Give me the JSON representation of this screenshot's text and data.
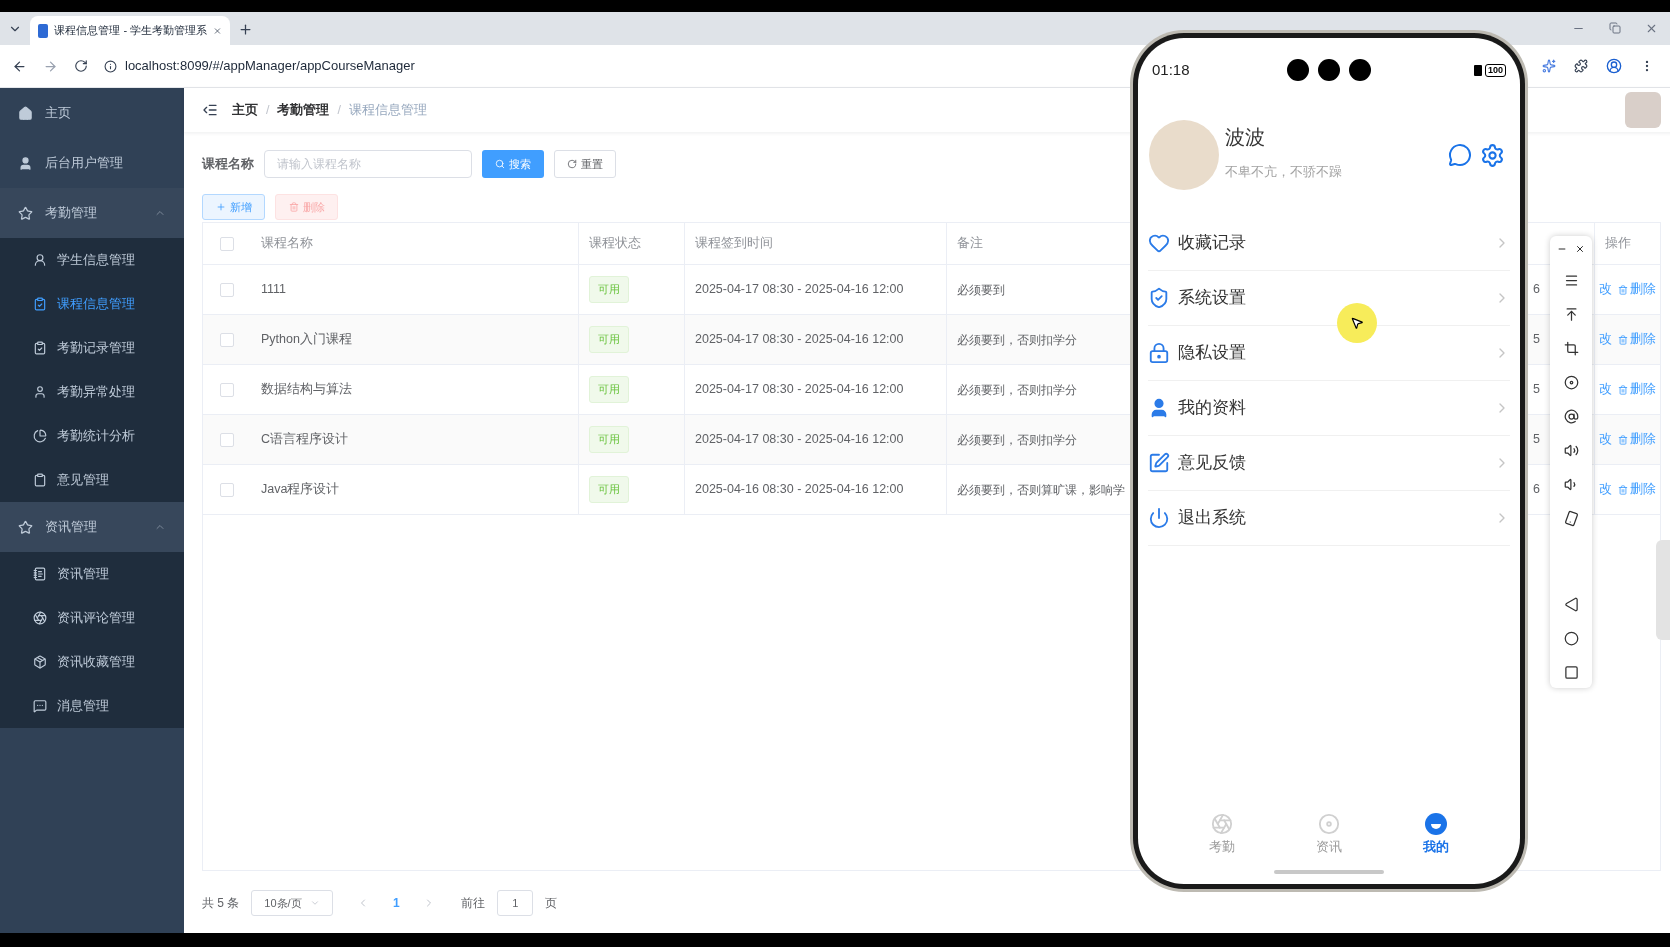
{
  "browser": {
    "tab_title": "课程信息管理 - 学生考勤管理系",
    "url": "localhost:8099/#/appManager/appCourseManager"
  },
  "sidebar": {
    "items": [
      {
        "label": "主页",
        "selected": false
      },
      {
        "label": "后台用户管理",
        "selected": false
      },
      {
        "label": "考勤管理",
        "selected": false,
        "expanded": true,
        "children": [
          {
            "label": "学生信息管理",
            "selected": false
          },
          {
            "label": "课程信息管理",
            "selected": true
          },
          {
            "label": "考勤记录管理",
            "selected": false
          },
          {
            "label": "考勤异常处理",
            "selected": false
          },
          {
            "label": "考勤统计分析",
            "selected": false
          },
          {
            "label": "意见管理",
            "selected": false
          }
        ]
      },
      {
        "label": "资讯管理",
        "selected": false,
        "expanded": true,
        "children": [
          {
            "label": "资讯管理",
            "selected": false
          },
          {
            "label": "资讯评论管理",
            "selected": false
          },
          {
            "label": "资讯收藏管理",
            "selected": false
          },
          {
            "label": "消息管理",
            "selected": false
          }
        ]
      }
    ]
  },
  "breadcrumb": {
    "separator": "/",
    "items": [
      "主页",
      "考勤管理",
      "课程信息管理"
    ]
  },
  "search": {
    "label": "课程名称",
    "placeholder": "请输入课程名称",
    "search_button": "搜索",
    "reset_button": "重置"
  },
  "actions": [
    {
      "label": "新增",
      "disabled": false
    },
    {
      "label": "删除",
      "disabled": true
    }
  ],
  "table": {
    "header_checked": false,
    "columns": [
      "课程名称",
      "课程状态",
      "课程签到时间",
      "备注",
      "操作"
    ],
    "rows": [
      {
        "checked": false,
        "name": "1111",
        "status": "可用",
        "time": "2025-04-17 08:30 - 2025-04-16 12:00",
        "remark": "必须要到",
        "column_5": "6",
        "actions": [
          "改",
          "删除"
        ]
      },
      {
        "checked": false,
        "name": "Python入门课程",
        "status": "可用",
        "time": "2025-04-17 08:30 - 2025-04-16 12:00",
        "remark": "必须要到，否则扣学分",
        "column_5": "5",
        "actions": [
          "改",
          "删除"
        ]
      },
      {
        "checked": false,
        "name": "数据结构与算法",
        "status": "可用",
        "time": "2025-04-17 08:30 - 2025-04-16 12:00",
        "remark": "必须要到，否则扣学分",
        "column_5": "5",
        "actions": [
          "改",
          "删除"
        ]
      },
      {
        "checked": false,
        "name": "C语言程序设计",
        "status": "可用",
        "time": "2025-04-17 08:30 - 2025-04-16 12:00",
        "remark": "必须要到，否则扣学分",
        "column_5": "5",
        "actions": [
          "改",
          "删除"
        ]
      },
      {
        "checked": false,
        "name": "Java程序设计",
        "status": "可用",
        "time": "2025-04-16 08:30 - 2025-04-16 12:00",
        "remark": "必须要到，否则算旷课，影响学",
        "column_5": "6",
        "actions": [
          "改",
          "删除"
        ]
      }
    ]
  },
  "pagination": {
    "total": "共 5 条",
    "page_size": "10条/页",
    "pages": [
      {
        "label": "1",
        "selected": true
      }
    ],
    "goto_label": "前往",
    "goto_value": "1",
    "goto_suffix": "页"
  },
  "phone": {
    "time": "01:18",
    "battery": "100",
    "profile": {
      "name": "波波",
      "motto": "不卑不亢，不骄不躁"
    },
    "menu": [
      {
        "label": "收藏记录"
      },
      {
        "label": "系统设置"
      },
      {
        "label": "隐私设置"
      },
      {
        "label": "我的资料"
      },
      {
        "label": "意见反馈"
      },
      {
        "label": "退出系统"
      }
    ],
    "tabs": [
      {
        "label": "考勤",
        "selected": false
      },
      {
        "label": "资讯",
        "selected": false
      },
      {
        "label": "我的",
        "selected": true
      }
    ]
  }
}
